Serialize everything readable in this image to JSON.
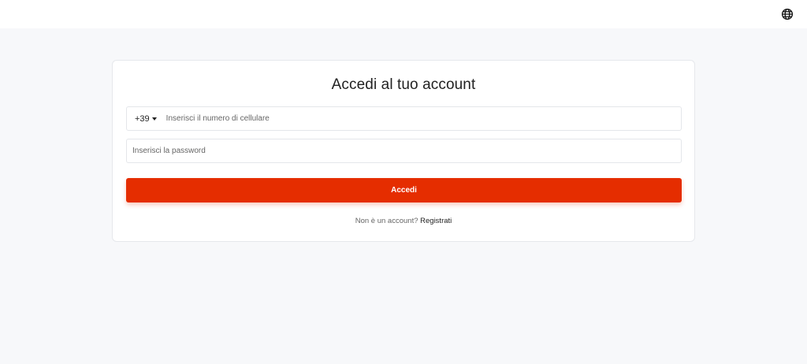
{
  "header": {
    "language_icon": "globe-icon"
  },
  "login": {
    "title": "Accedi al tuo account",
    "phone": {
      "country_code": "+39",
      "placeholder": "Inserisci il numero di cellulare",
      "value": ""
    },
    "password": {
      "placeholder": "Inserisci la password",
      "value": ""
    },
    "submit_label": "Accedi",
    "signup_prompt": "Non è un account?",
    "signup_link": "Registrati"
  },
  "colors": {
    "accent": "#e52d00",
    "background": "#f7f8fa",
    "card": "#ffffff"
  }
}
